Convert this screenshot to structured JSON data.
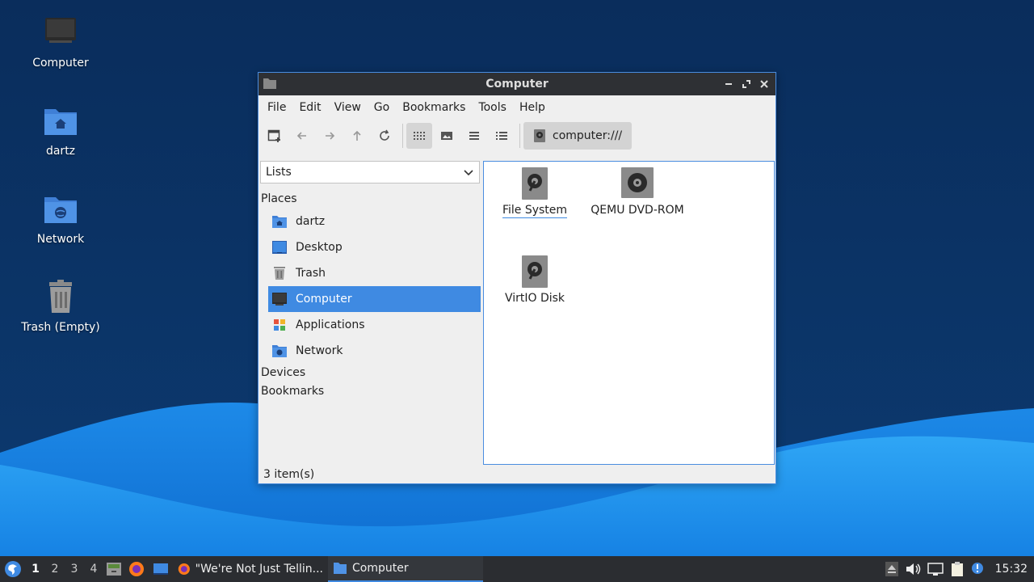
{
  "desktop": {
    "icons": [
      {
        "label": "Computer"
      },
      {
        "label": "dartz"
      },
      {
        "label": "Network"
      },
      {
        "label": "Trash (Empty)"
      }
    ]
  },
  "window": {
    "title": "Computer",
    "menu": [
      "File",
      "Edit",
      "View",
      "Go",
      "Bookmarks",
      "Tools",
      "Help"
    ],
    "location": "computer:///",
    "sidebar": {
      "select_value": "Lists",
      "places_heading": "Places",
      "places": [
        {
          "label": "dartz",
          "icon": "home-folder-icon"
        },
        {
          "label": "Desktop",
          "icon": "desktop-icon"
        },
        {
          "label": "Trash",
          "icon": "trash-icon"
        },
        {
          "label": "Computer",
          "icon": "computer-icon",
          "selected": true
        },
        {
          "label": "Applications",
          "icon": "applications-icon"
        },
        {
          "label": "Network",
          "icon": "network-folder-icon"
        }
      ],
      "devices_heading": "Devices",
      "bookmarks_heading": "Bookmarks"
    },
    "items": [
      {
        "label": "File System",
        "icon": "drive-icon"
      },
      {
        "label": "QEMU DVD-ROM",
        "icon": "optical-drive-icon"
      },
      {
        "label": "VirtIO Disk",
        "icon": "drive-icon"
      }
    ],
    "status": "3 item(s)"
  },
  "taskbar": {
    "workspaces": [
      "1",
      "2",
      "3",
      "4"
    ],
    "tasks": [
      {
        "label": "\"We're Not Just Tellin..."
      },
      {
        "label": "Computer"
      }
    ],
    "clock": "15:32"
  },
  "colors": {
    "accent": "#3f8ae2",
    "titlebar": "#2e3034",
    "taskbar": "#2b2d31",
    "desktop": "#0b2b5a"
  }
}
